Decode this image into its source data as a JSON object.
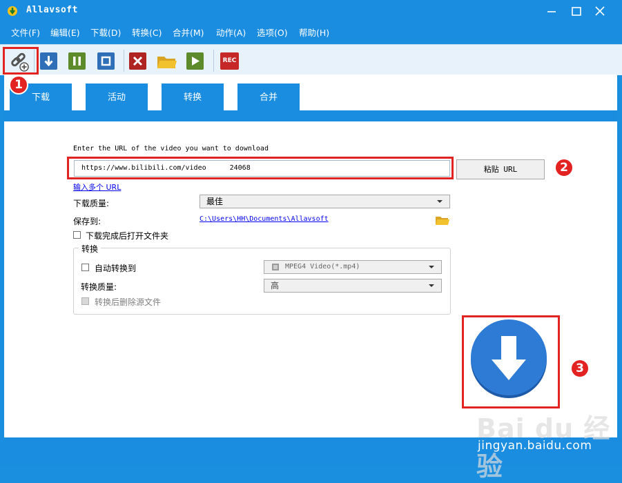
{
  "window": {
    "title": "Allavsoft"
  },
  "menu": [
    "文件(F)",
    "编辑(E)",
    "下载(D)",
    "转换(C)",
    "合并(M)",
    "动作(A)",
    "选项(O)",
    "帮助(H)"
  ],
  "toolbar": {
    "rec_label": "REC"
  },
  "tabs": [
    "下载",
    "活动",
    "转换",
    "合并"
  ],
  "form": {
    "prompt": "Enter the URL of the video you want to download",
    "url_value_prefix": "https://www.bilibili.com/video",
    "url_value_suffix": "24068",
    "paste_label": "粘贴 URL",
    "multi_url_link": "输入多个 URL",
    "quality_label": "下载质量:",
    "quality_value": "最佳",
    "save_label": "保存到:",
    "save_path": "C:\\Users\\HH\\Documents\\Allavsoft",
    "open_folder_label": "下载完成后打开文件夹",
    "convert_section_title": "转换",
    "auto_convert_label": "自动转换到",
    "format_value": "MPEG4 Video(*.mp4)",
    "convert_quality_label": "转换质量:",
    "convert_quality_value": "高",
    "delete_source_label": "转换后删除源文件"
  },
  "annotations": [
    "1",
    "2",
    "3"
  ],
  "watermark": {
    "logo": "Bai du 经验",
    "url": "jingyan.baidu.com"
  },
  "colors": {
    "brand": "#1b8de0",
    "accent_red": "#e32222",
    "download_blue": "#2e7bd6"
  }
}
